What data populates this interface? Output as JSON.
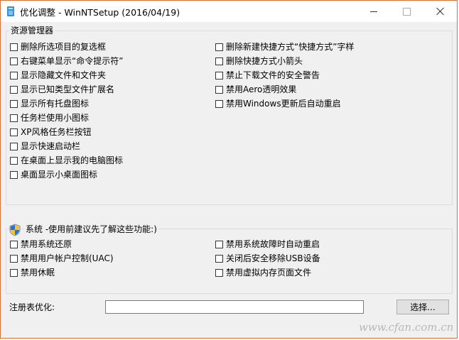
{
  "window": {
    "title": "优化调整 - WinNTSetup (2016/04/19)",
    "border_color": "#d2713a"
  },
  "explorer": {
    "legend": "资源管理器",
    "left_options": [
      {
        "label": "删除所选项目的复选框",
        "checked": false
      },
      {
        "label": "右键菜单显示“命令提示符”",
        "checked": false
      },
      {
        "label": "显示隐藏文件和文件夹",
        "checked": false
      },
      {
        "label": "显示已知类型文件扩展名",
        "checked": false
      },
      {
        "label": "显示所有托盘图标",
        "checked": false
      },
      {
        "label": "任务栏使用小图标",
        "checked": false
      },
      {
        "label": "XP风格任务栏按钮",
        "checked": false
      },
      {
        "label": "显示快速启动栏",
        "checked": false
      },
      {
        "label": "在桌面上显示我的电脑图标",
        "checked": false
      },
      {
        "label": "桌面显示小桌面图标",
        "checked": false
      }
    ],
    "right_options": [
      {
        "label": "删除新建快捷方式“快捷方式”字样",
        "checked": false
      },
      {
        "label": "删除快捷方式小箭头",
        "checked": false
      },
      {
        "label": "禁止下载文件的安全警告",
        "checked": false
      },
      {
        "label": "禁用Aero透明效果",
        "checked": false
      },
      {
        "label": "禁用Windows更新后自动重启",
        "checked": false
      }
    ]
  },
  "system": {
    "legend": "系统 -使用前建议先了解这些功能:)",
    "left_options": [
      {
        "label": "禁用系统还原",
        "checked": false
      },
      {
        "label": "禁用用户帐户控制(UAC)",
        "checked": false
      },
      {
        "label": "禁用休眠",
        "checked": false
      }
    ],
    "right_options": [
      {
        "label": "禁用系统故障时自动重启",
        "checked": false
      },
      {
        "label": "关闭后安全移除USB设备",
        "checked": false
      },
      {
        "label": "禁用虚拟内存页面文件",
        "checked": false
      }
    ]
  },
  "registry": {
    "label": "注册表优化:",
    "value": "",
    "browse_label": "选择..."
  },
  "watermark": "www.cfan.com.cn"
}
